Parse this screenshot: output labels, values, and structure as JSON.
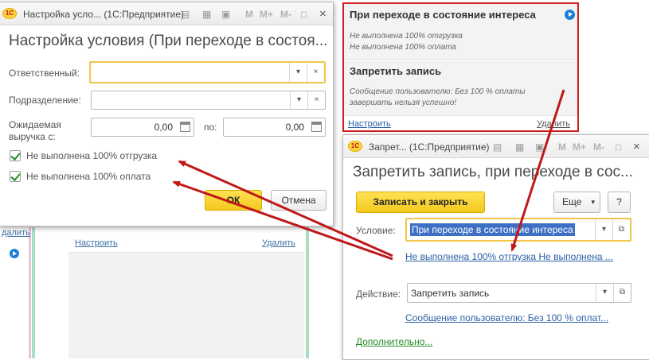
{
  "background": {
    "link_setup": "Настроить",
    "link_delete": "Удалить",
    "link_delete_left": "далить"
  },
  "dialog1": {
    "titlebar": "Настройка усло... (1С:Предприятие)",
    "title": "Настройка условия (При переходе в состоя...",
    "responsible_label": "Ответственный:",
    "responsible_value": "",
    "department_label": "Подразделение:",
    "department_value": "",
    "revenue_label_1": "Ожидаемая",
    "revenue_label_2": "выручка с:",
    "revenue_from": "0,00",
    "revenue_to_label": "по:",
    "revenue_to": "0,00",
    "check1_label": "Не выполнена 100% отгрузка",
    "check2_label": "Не выполнена 100% оплата",
    "ok_label": "ОК",
    "cancel_label": "Отмена",
    "icons": [
      "print-icon",
      "calc-icon",
      "calendar-icon",
      "M",
      "M+",
      "M-",
      "maximize-icon",
      "close-icon"
    ],
    "m_labels": [
      "M",
      "M+",
      "M-"
    ]
  },
  "red_panel": {
    "heading1": "При переходе в состояние интереса",
    "cond1": "Не выполнена 100% отгрузка",
    "cond2": "Не выполнена 100% оплата",
    "heading2": "Запретить запись",
    "action_text1": "Сообщение пользователю: Без 100 % оплаты",
    "action_text2": "завершать нельзя успешно!",
    "link_setup": "Настроить",
    "link_delete": "Удалить"
  },
  "dialog2": {
    "titlebar": "Запрет... (1С:Предприятие)",
    "title": "Запретить запись, при переходе в сос...",
    "save_close_label": "Записать и закрыть",
    "more_label": "Еще",
    "help_label": "?",
    "condition_label": "Условие:",
    "condition_value": "При переходе в состояние интереса",
    "condition_link": "Не выполнена 100% отгрузка Не выполнена ...",
    "action_label": "Действие:",
    "action_value": "Запретить запись",
    "action_link": "Сообщение пользователю: Без 100 % оплат...",
    "more_link": "Дополнительно...",
    "m_labels": [
      "M",
      "M+",
      "M-"
    ]
  },
  "colors": {
    "accent_yellow": "#f4c81e",
    "link_blue": "#2a5fa5",
    "arrow_red": "#c01818",
    "frame_red": "#d21f1f",
    "check_green": "#2b8a2b"
  }
}
